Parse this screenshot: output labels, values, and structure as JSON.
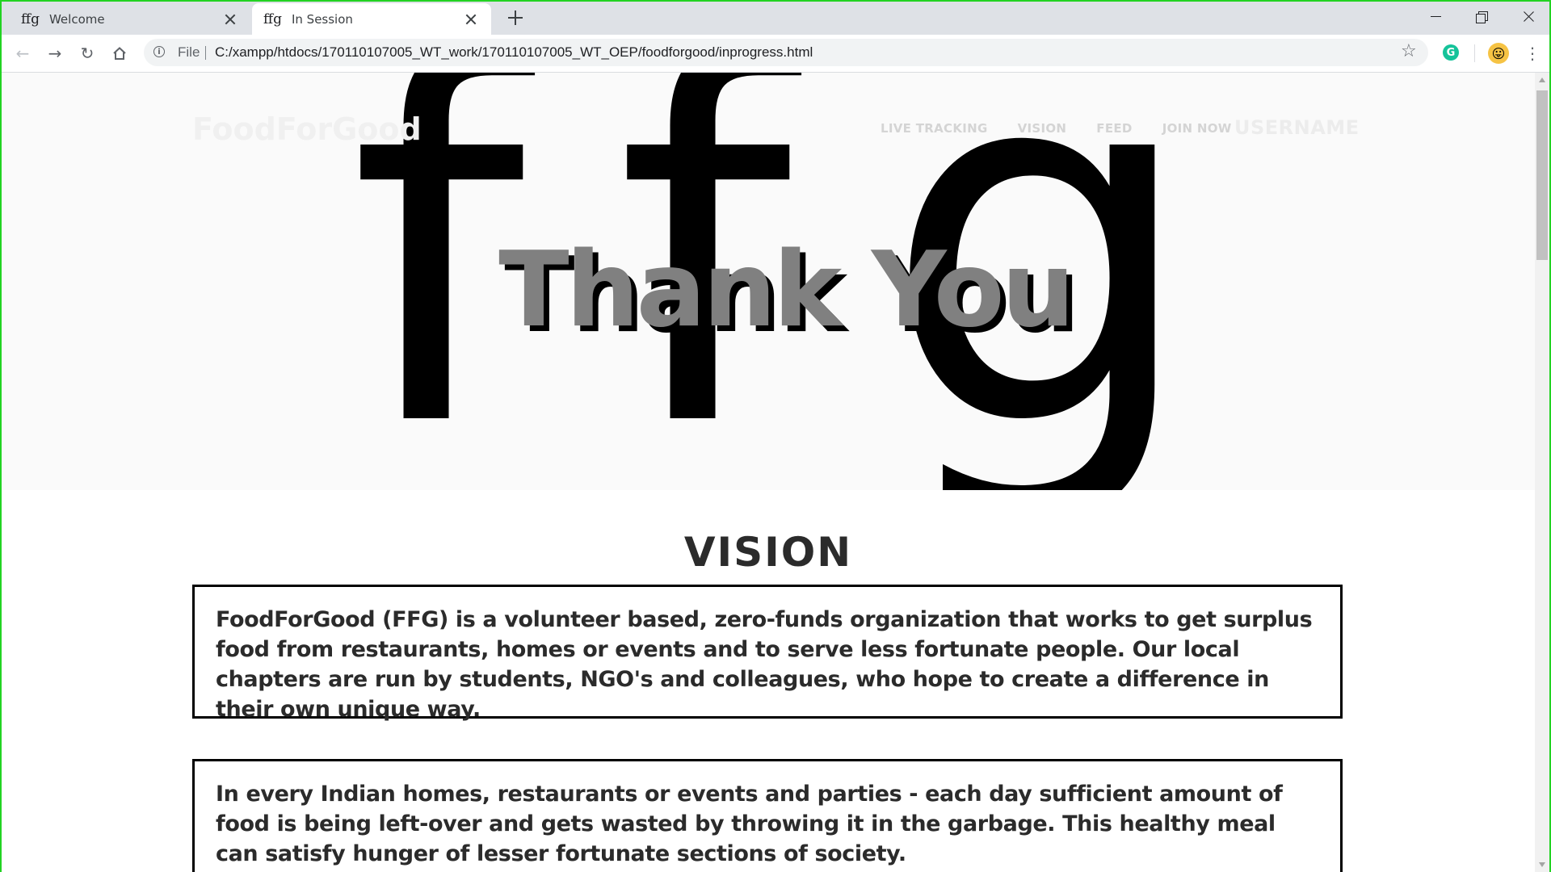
{
  "browser": {
    "tabs": [
      {
        "favicon": "ffg",
        "title": "Welcome",
        "active": false
      },
      {
        "favicon": "ffg",
        "title": "In Session",
        "active": true
      }
    ],
    "address": {
      "scheme_label": "File",
      "url": "C:/xampp/htdocs/170110107005_WT_work/170110107005_WT_OEP/foodforgood/inprogress.html"
    },
    "extension_letter": "G",
    "icons": {
      "back": "arrow-left-icon",
      "forward": "arrow-right-icon",
      "reload": "reload-icon",
      "home": "home-icon",
      "info": "info-icon",
      "bookmark": "star-icon",
      "menu": "more-vert-icon"
    }
  },
  "site": {
    "brand": "FoodForGood",
    "nav": [
      "LIVE TRACKING",
      "VISION",
      "FEED",
      "JOIN NOW"
    ],
    "username": "USERNAME",
    "hero_letters": [
      "f",
      "f",
      "g"
    ],
    "hero_heading": "Thank You",
    "vision_title": "VISION",
    "paragraphs": [
      "FoodForGood (FFG) is a volunteer based, zero-funds organization that works to get surplus food from restaurants, homes or events and to serve less fortunate people. Our local chapters are run by students, NGO's and colleagues, who hope to create a difference in their own unique way.",
      "In every Indian homes, restaurants or events and parties - each day sufficient amount of food is being left-over and gets wasted by throwing it in the garbage. This healthy meal can satisfy hunger of lesser fortunate sections of society."
    ]
  },
  "colors": {
    "frame_border": "#22d322",
    "tab_strip": "#dee1e6",
    "heading_fill": "#808080",
    "heading_shadow": "#000000",
    "text_dark": "#2b2b2b"
  }
}
